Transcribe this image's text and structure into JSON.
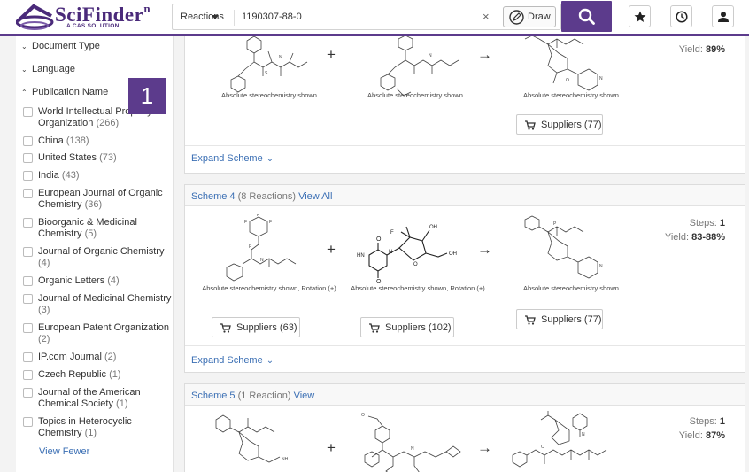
{
  "header": {
    "logo_text": "SciFinder",
    "logo_sup": "n",
    "logo_sub": "A CAS SOLUTION",
    "search_type": "Reactions",
    "search_value": "1190307-88-0",
    "clear_glyph": "×",
    "draw_label": "Draw"
  },
  "sidebar": {
    "facets": [
      {
        "label": "Document Type",
        "caret": "⌄"
      },
      {
        "label": "Language",
        "caret": "⌄"
      },
      {
        "label": "Publication Name",
        "caret": "⌃"
      }
    ],
    "items": [
      {
        "label": "World Intellectual Property Organization",
        "count": "(266)"
      },
      {
        "label": "China",
        "count": "(138)"
      },
      {
        "label": "United States",
        "count": "(73)"
      },
      {
        "label": "India",
        "count": "(43)"
      },
      {
        "label": "European Journal of Organic Chemistry",
        "count": "(36)"
      },
      {
        "label": "Bioorganic & Medicinal Chemistry",
        "count": "(5)"
      },
      {
        "label": "Journal of Organic Chemistry",
        "count": "(4)"
      },
      {
        "label": "Organic Letters",
        "count": "(4)"
      },
      {
        "label": "Journal of Medicinal Chemistry",
        "count": "(3)"
      },
      {
        "label": "European Patent Organization",
        "count": "(2)"
      },
      {
        "label": "IP.com Journal",
        "count": "(2)"
      },
      {
        "label": "Czech Republic",
        "count": "(1)"
      },
      {
        "label": "Journal of the American Chemical Society",
        "count": "(1)"
      },
      {
        "label": "Topics in Heterocyclic Chemistry",
        "count": "(1)"
      }
    ],
    "view_fewer": "View Fewer",
    "badge": "1"
  },
  "scheme3": {
    "caption_1": "Absolute stereochemistry shown",
    "caption_2": "Absolute stereochemistry shown",
    "caption_3": "Absolute stereochemistry shown",
    "suppliers_3": "Suppliers (77)",
    "yield_label": "Yield:",
    "yield_value": "89%",
    "expand": "Expand Scheme"
  },
  "scheme4": {
    "title": "Scheme 4",
    "info": "(8 Reactions)",
    "view": "View All",
    "caption_1": "Absolute stereochemistry shown, Rotation (+)",
    "caption_2": "Absolute stereochemistry shown, Rotation (+)",
    "caption_3": "Absolute stereochemistry shown",
    "suppliers_1": "Suppliers (63)",
    "suppliers_2": "Suppliers (102)",
    "suppliers_3": "Suppliers (77)",
    "steps_label": "Steps:",
    "steps_value": "1",
    "yield_label": "Yield:",
    "yield_value": "83-88%",
    "expand": "Expand Scheme"
  },
  "scheme5": {
    "title": "Scheme 5",
    "info": "(1 Reaction)",
    "view": "View",
    "steps_label": "Steps:",
    "steps_value": "1",
    "yield_label": "Yield:",
    "yield_value": "87%"
  },
  "symbols": {
    "plus": "+",
    "arrow": "→",
    "chevron": "⌄"
  },
  "colors": {
    "brand": "#5c3b8c",
    "link": "#3b6fb4"
  }
}
